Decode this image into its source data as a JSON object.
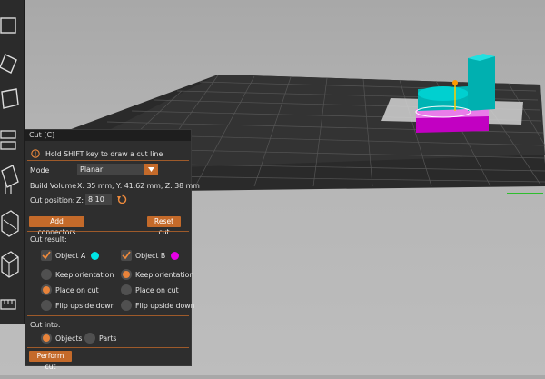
{
  "panel": {
    "title": "Cut [C]",
    "hint": "Hold SHIFT key to draw a cut line",
    "mode_label": "Mode",
    "mode_value": "Planar",
    "build_volume_label": "Build Volume",
    "build_volume_value": "X: 35 mm,  Y: 41.62 mm,  Z: 38 mm",
    "cut_position_label": "Cut position:",
    "z_label": "Z:",
    "z_value": "8.10",
    "add_connectors": "Add connectors",
    "reset_cut": "Reset cut",
    "cut_result_label": "Cut result:",
    "object_a": {
      "label": "Object A",
      "checked": true,
      "color": "#00e5e5"
    },
    "object_b": {
      "label": "Object B",
      "checked": true,
      "color": "#e600e6"
    },
    "options_a": [
      {
        "label": "Keep orientation",
        "selected": false
      },
      {
        "label": "Place on cut",
        "selected": true
      },
      {
        "label": "Flip upside down",
        "selected": false
      }
    ],
    "options_b": [
      {
        "label": "Keep orientation",
        "selected": true
      },
      {
        "label": "Place on cut",
        "selected": false
      },
      {
        "label": "Flip upside down",
        "selected": false
      }
    ],
    "cut_into_label": "Cut into:",
    "cut_into": [
      {
        "label": "Objects",
        "selected": true
      },
      {
        "label": "Parts",
        "selected": false
      }
    ],
    "perform_cut": "Perform cut"
  },
  "toolbar": {
    "tools": [
      "cube-icon",
      "move-icon",
      "rotate-icon",
      "scale-icon",
      "cut-icon",
      "supports-icon",
      "seam-icon",
      "box-icon",
      "measure-icon"
    ]
  },
  "colors": {
    "accent": "#c46a2a",
    "object_a": "#00e5e5",
    "object_b": "#e600e6",
    "bed": "#2a2a2a"
  }
}
